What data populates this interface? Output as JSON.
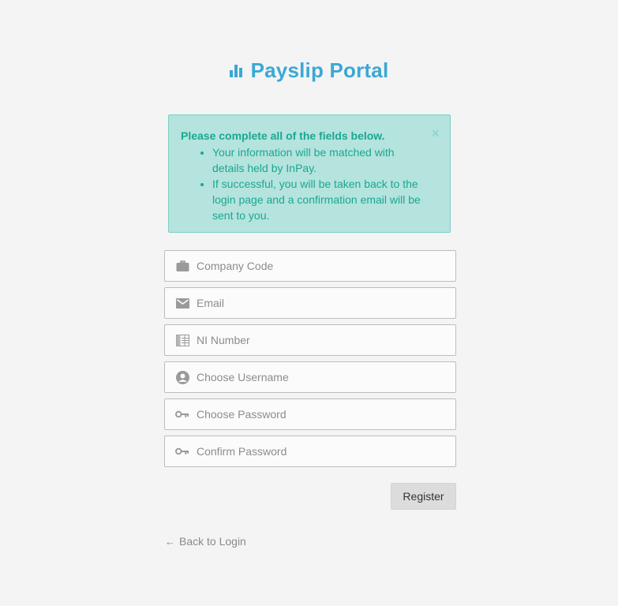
{
  "brand": {
    "title": "Payslip Portal",
    "icon": "bar-chart-icon",
    "color": "#3aa8d6"
  },
  "alert": {
    "heading": "Please complete all of the fields below.",
    "items": [
      "Your information will be matched with details held by InPay.",
      "If successful, you will be taken back to the login page and a confirmation email will be sent to you."
    ],
    "close_label": "×",
    "background": "#b5e3de",
    "text_color": "#1aa88f"
  },
  "form": {
    "fields": [
      {
        "placeholder": "Company Code",
        "value": "",
        "icon": "briefcase-icon"
      },
      {
        "placeholder": "Email",
        "value": "",
        "icon": "envelope-icon"
      },
      {
        "placeholder": "NI Number",
        "value": "",
        "icon": "id-card-icon"
      },
      {
        "placeholder": "Choose Username",
        "value": "",
        "icon": "user-circle-icon"
      },
      {
        "placeholder": "Choose Password",
        "value": "",
        "icon": "key-icon"
      },
      {
        "placeholder": "Confirm Password",
        "value": "",
        "icon": "key-icon"
      }
    ],
    "register_label": "Register"
  },
  "footer": {
    "back_label": "Back to Login",
    "back_icon": "arrow-left-icon"
  }
}
